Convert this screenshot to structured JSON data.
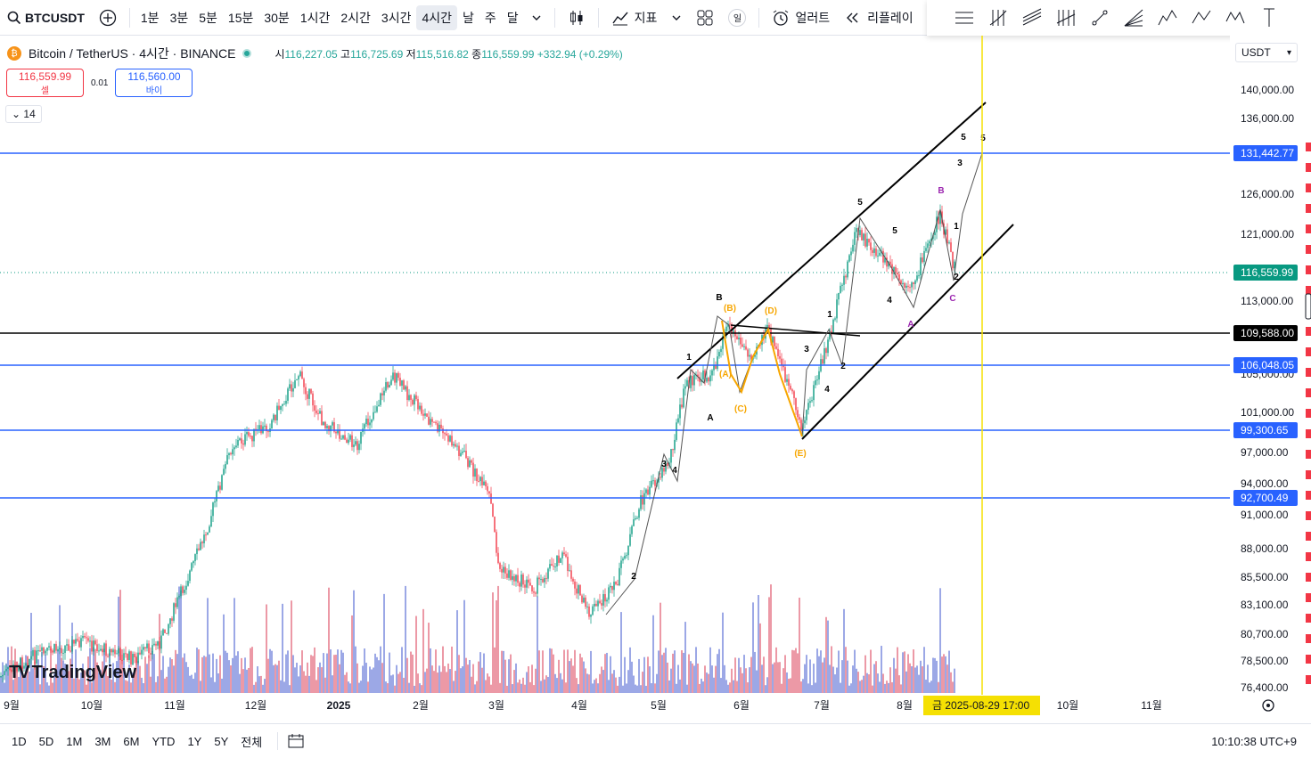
{
  "symbol": "BTCUSDT",
  "timeframes": [
    "1분",
    "3분",
    "5분",
    "15분",
    "30분",
    "1시간",
    "2시간",
    "3시간",
    "4시간",
    "날",
    "주",
    "달"
  ],
  "active_timeframe": "4시간",
  "toolbar": {
    "indicators_label": "지표",
    "alert_label": "얼러트",
    "replay_label": "리플레이",
    "chart_type_badge": "일"
  },
  "legend": {
    "title": "Bitcoin / TetherUS · 4시간 · BINANCE",
    "open_label": "시",
    "open": "116,227.05",
    "high_label": "고",
    "high": "116,725.69",
    "low_label": "저",
    "low": "115,516.82",
    "close_label": "종",
    "close": "116,559.99",
    "change": "+332.94 (+0.29%)"
  },
  "trade": {
    "sell_price": "116,559.99",
    "sell_label": "셀",
    "spread": "0.01",
    "buy_price": "116,560.00",
    "buy_label": "바이"
  },
  "indicator_count": "14",
  "currency": "USDT",
  "price_axis": [
    "140,000.00",
    "136,000.00",
    "126,000.00",
    "121,000.00",
    "113,000.00",
    "105,000.00",
    "101,000.00",
    "97,000.00",
    "94,000.00",
    "91,000.00",
    "88,000.00",
    "85,500.00",
    "83,100.00",
    "80,700.00",
    "78,500.00",
    "76,400.00"
  ],
  "level_tags": [
    {
      "label": "131,442.77",
      "color": "#2962ff"
    },
    {
      "label": "116,559.99",
      "color": "#089981"
    },
    {
      "label": "109,588.00",
      "color": "#000000"
    },
    {
      "label": "106,048.05",
      "color": "#2962ff"
    },
    {
      "label": "99,300.65",
      "color": "#2962ff"
    },
    {
      "label": "92,700.49",
      "color": "#2962ff"
    }
  ],
  "time_axis": [
    "9월",
    "10월",
    "11월",
    "12월",
    "2025",
    "2월",
    "3월",
    "4월",
    "5월",
    "6월",
    "7월",
    "8월",
    "10월",
    "11월"
  ],
  "cursor_time": "금 2025-08-29   17:00",
  "watermark": "TradingView",
  "ranges": [
    "1D",
    "5D",
    "1M",
    "3M",
    "6M",
    "YTD",
    "1Y",
    "5Y",
    "전체"
  ],
  "clock": "10:10:38 UTC+9",
  "wave_labels": [
    "1",
    "2",
    "3",
    "4",
    "5",
    "A",
    "B",
    "C",
    "(A)",
    "(B)",
    "(C)",
    "(D)",
    "(E)"
  ],
  "colors": {
    "up": "#089981",
    "down": "#f23645",
    "level_line": "#2962ff",
    "cursor": "#f5e003",
    "wave_orange": "#f7a600",
    "wave_purple": "#9c27b0"
  }
}
